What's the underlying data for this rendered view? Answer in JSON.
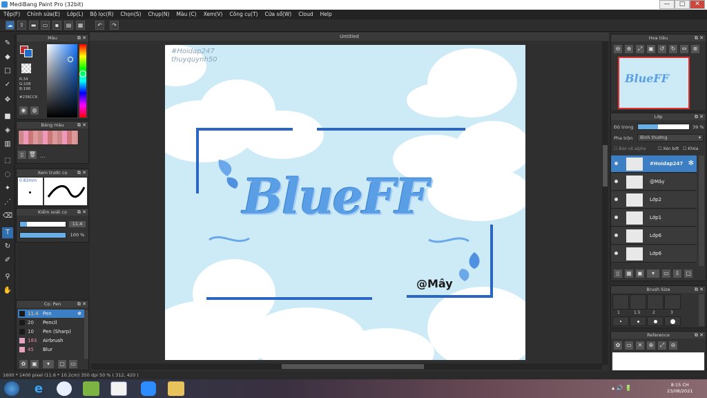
{
  "window": {
    "title": "MediBang Paint Pro (32bit)",
    "min": "—",
    "max": "□",
    "close": "✕"
  },
  "menu": [
    "Tệp(F)",
    "Chỉnh sửa(E)",
    "Lớp(L)",
    "Bộ lọc(R)",
    "Chọn(S)",
    "Chụp(N)",
    "Màu (C)",
    "Xem(V)",
    "Công cụ(T)",
    "Cửa sổ(W)",
    "Cloud",
    "Help"
  ],
  "colors": {
    "accent": "#3d7fc4",
    "primary": "#236CC6",
    "sky": "#cdeaf7"
  },
  "color_panel": {
    "title": "Màu",
    "r": "R:34",
    "g": "G:108",
    "b": "B:198",
    "hex": "#236CC6"
  },
  "palette_panel": {
    "title": "Bảng màu",
    "more": "..."
  },
  "preview_panel": {
    "title": "Xem trước cọ",
    "size": "0.83mm"
  },
  "control_panel": {
    "title": "Kiểm soát cọ",
    "size_value": "11.4",
    "opacity_value": "100 %"
  },
  "brush_panel": {
    "title": "Cọ: Pen",
    "brushes": [
      {
        "size": "11.4",
        "name": "Pen",
        "color": "#1a1a1a"
      },
      {
        "size": "20",
        "name": "Pencil",
        "color": "#1a1a1a"
      },
      {
        "size": "10",
        "name": "Pen (Sharp)",
        "color": "#1a1a1a"
      },
      {
        "size": "183",
        "name": "Airbrush",
        "color": "#e6a4c0"
      },
      {
        "size": "45",
        "name": "Blur",
        "color": "#e6a4c0"
      }
    ]
  },
  "document": {
    "tab": "Untitled",
    "watermark1": "#Hoidap247",
    "watermark2": "thuyquynh50",
    "title_text": "BlueFF",
    "signature": "@Mây"
  },
  "navigator": {
    "title": "Hoa tiêu",
    "thumb_text": "BlueFF"
  },
  "layer_panel": {
    "title": "Lớp",
    "opacity_label": "Độ trong",
    "opacity_value": "39 %",
    "blend_label": "Pha trộn",
    "blend_value": "Bình thường",
    "protect_alpha": "Bảo vệ alpha",
    "clip": "Xén bớt",
    "lock": "Khóa",
    "layers": [
      {
        "name": "#Hoidap247",
        "selected": true
      },
      {
        "name": "@Mây",
        "selected": false
      },
      {
        "name": "Lớp2",
        "selected": false
      },
      {
        "name": "Lớp1",
        "selected": false
      },
      {
        "name": "Lớp6",
        "selected": false
      },
      {
        "name": "Lớp6",
        "selected": false
      }
    ]
  },
  "brush_size_panel": {
    "title": "Brush Size",
    "labels": [
      "1",
      "1.5",
      "2",
      "3"
    ]
  },
  "reference_panel": {
    "title": "Reference"
  },
  "status": {
    "text": "1600 * 1400 pixel  (11.6 * 10.2cm)  350 dpi  50 %  ( 312, 420 )"
  },
  "taskbar": {
    "time": "8:15 CH",
    "date": "23/08/2021"
  }
}
